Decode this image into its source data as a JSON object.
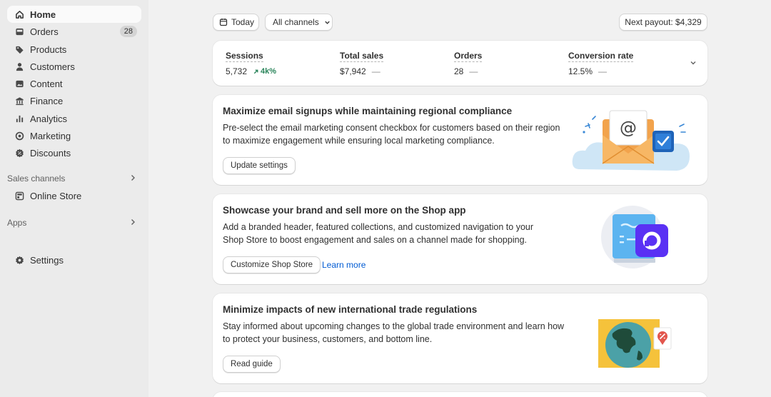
{
  "sidebar": {
    "items": [
      {
        "label": "Home",
        "icon": "home-icon"
      },
      {
        "label": "Orders",
        "icon": "inbox-icon",
        "badge": "28"
      },
      {
        "label": "Products",
        "icon": "tag-icon"
      },
      {
        "label": "Customers",
        "icon": "person-icon"
      },
      {
        "label": "Content",
        "icon": "image-icon"
      },
      {
        "label": "Finance",
        "icon": "bank-icon"
      },
      {
        "label": "Analytics",
        "icon": "bar-chart-icon"
      },
      {
        "label": "Marketing",
        "icon": "target-icon"
      },
      {
        "label": "Discounts",
        "icon": "discount-icon"
      }
    ],
    "sales_channels_label": "Sales channels",
    "online_store_label": "Online Store",
    "apps_label": "Apps",
    "settings_label": "Settings"
  },
  "toolbar": {
    "date_label": "Today",
    "channels_label": "All channels",
    "payout_label": "Next payout: $4,329"
  },
  "metrics": [
    {
      "label": "Sessions",
      "value": "5,732",
      "trend": "4k%"
    },
    {
      "label": "Total sales",
      "value": "$7,942",
      "trend": "—"
    },
    {
      "label": "Orders",
      "value": "28",
      "trend": "—"
    },
    {
      "label": "Conversion rate",
      "value": "12.5%",
      "trend": "—"
    }
  ],
  "cards": [
    {
      "title": "Maximize email signups while maintaining regional compliance",
      "body": "Pre-select the email marketing consent checkbox for customers based on their region to maximize engagement while ensuring local marketing compliance.",
      "button": "Update settings"
    },
    {
      "title": "Showcase your brand and sell more on the Shop app",
      "body": "Add a branded header, featured collections, and customized navigation to your Shop Store to boost engagement and sales on a channel made for shopping.",
      "button": "Customize Shop Store",
      "link": "Learn more"
    },
    {
      "title": "Minimize impacts of new international trade regulations",
      "body": "Stay informed about upcoming changes to the global trade environment and learn how to protect your business, customers, and bottom line.",
      "button": "Read guide"
    }
  ],
  "colors": {
    "accent_green": "#29845a",
    "link_blue": "#005bd3",
    "envelope_orange": "#f2a34c",
    "shop_purple": "#5a31f4"
  }
}
